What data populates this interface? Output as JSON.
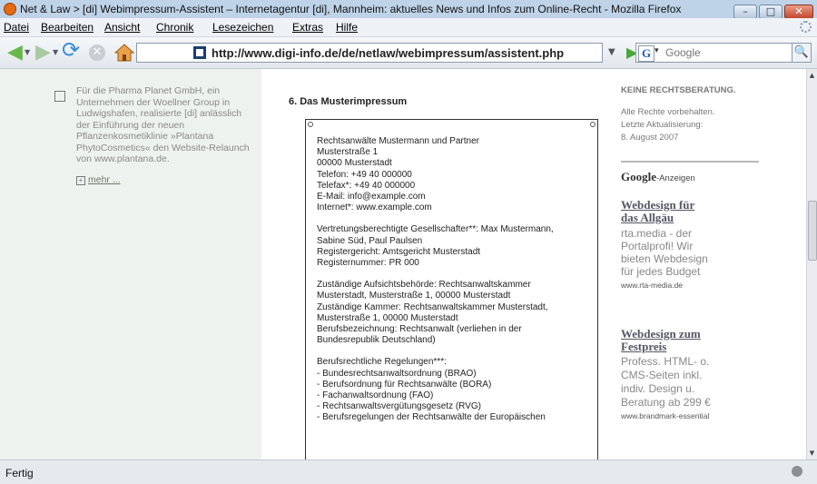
{
  "window": {
    "title": "Net & Law > [di] Webimpressum-Assistent – Internetagentur [di], Mannheim: aktuelles News und Infos zum Online-Recht - Mozilla Firefox"
  },
  "menu": [
    "Datei",
    "Bearbeiten",
    "Ansicht",
    "Chronik",
    "Lesezeichen",
    "Extras",
    "Hilfe"
  ],
  "nav": {
    "url": "http://www.digi-info.de/de/netlaw/webimpressum/assistent.php",
    "search_placeholder": "Google"
  },
  "left": {
    "lines": [
      "Für die Pharma Planet GmbH, ein",
      "Unternehmen der Woellner Group in",
      "Ludwigshafen, realisierte [di] anlässlich",
      "der Einführung der neuen",
      "Pflanzenkosmetiklinie »Plantana",
      "PhytoCosmetics« den Website-Relaunch",
      "von www.plantana.de."
    ],
    "more": "mehr ..."
  },
  "main": {
    "section": "6.  Das Musterimpressum",
    "imprint": [
      "Rechtsanwälte Mustermann und Partner",
      "Musterstraße 1",
      "00000 Musterstadt",
      "Telefon: +49 40 000000",
      "Telefax*: +49 40 000000",
      "E-Mail: info@example.com",
      "Internet*: www.example.com",
      "",
      "Vertretungsberechtigte Gesellschafter**: Max Mustermann,",
      "Sabine Süd, Paul Paulsen",
      "Registergericht: Amtsgericht Musterstadt",
      "Registernummer: PR 000",
      "",
      "Zuständige Aufsichtsbehörde: Rechtsanwaltskammer",
      "Musterstadt, Musterstraße 1, 00000 Musterstadt",
      "Zuständige Kammer: Rechtsanwaltskammer Musterstadt,",
      "Musterstraße 1, 00000 Musterstadt",
      "Berufsbezeichnung: Rechtsanwalt (verliehen in der",
      "Bundesrepublik Deutschland)",
      "",
      "Berufsrechtliche Regelungen***:",
      "- Bundesrechtsanwaltsordnung (BRAO)",
      "- Berufsordnung für Rechtsanwälte (BORA)",
      "- Fachanwaltsordnung (FAO)",
      "- Rechtsanwaltsvergütungsgesetz (RVG)",
      "- Berufsregelungen der Rechtsanwälte der Europäischen"
    ]
  },
  "right": {
    "top": "KEINE RECHTSBERATUNG.",
    "rights": "Alle Rechte vorbehalten.",
    "updated_label": "Letzte Aktualisierung:",
    "updated_date": "8. August 2007",
    "ads_google": "Google",
    "ads_label": "-Anzeigen",
    "ads": [
      {
        "title1": "Webdesign für",
        "title2": "das Allgäu",
        "body": [
          "rta.media - der",
          "Portalprofi! Wir",
          "bieten Webdesign",
          "für jedes Budget"
        ],
        "url": "www.rta-media.de"
      },
      {
        "title1": "Webdesign zum",
        "title2": "Festpreis",
        "body": [
          "Profess. HTML- o.",
          "CMS-Seiten inkl.",
          "indiv. Design u.",
          "Beratung ab 299 €"
        ],
        "url": "www.brandmark-essential"
      }
    ]
  },
  "status": {
    "text": "Fertig"
  }
}
